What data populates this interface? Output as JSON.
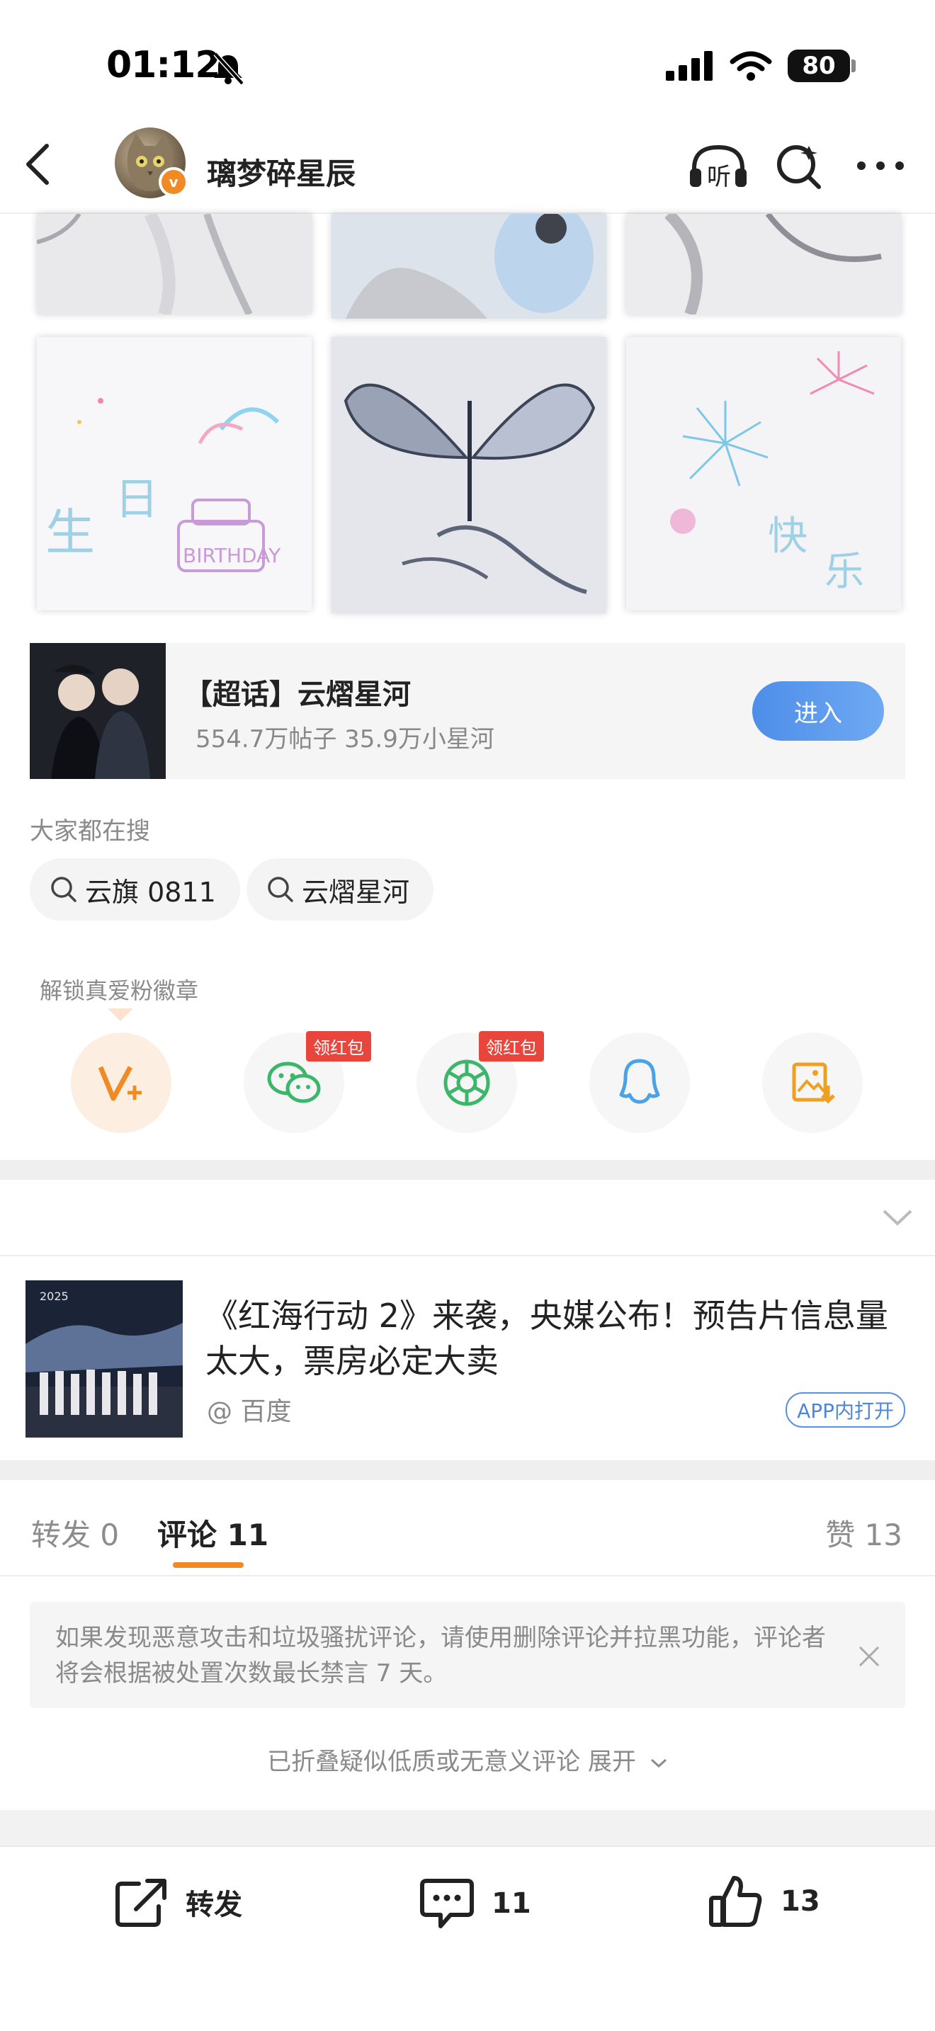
{
  "status_bar": {
    "time": "01:12",
    "battery": "80"
  },
  "nav": {
    "title": "璃梦碎星辰",
    "badge": "v",
    "listen_label": "听"
  },
  "super_topic": {
    "title": "【超话】云熠星河",
    "stats": "554.7万帖子  35.9万小星河",
    "enter_label": "进入"
  },
  "trending": {
    "label": "大家都在搜",
    "items": [
      {
        "text": "云旗 0811"
      },
      {
        "text": "云熠星河"
      }
    ]
  },
  "share": {
    "unlock_label": "解锁真爱粉徽章",
    "redpack_label": "领红包",
    "items": [
      {
        "icon": "vplus-icon"
      },
      {
        "icon": "wechat-icon"
      },
      {
        "icon": "moments-icon"
      },
      {
        "icon": "qq-icon"
      },
      {
        "icon": "save-image-icon"
      }
    ]
  },
  "link_card": {
    "title": "《红海行动 2》来袭，央媒公布！预告片信息量太大，票房必定大卖",
    "source": "@ 百度",
    "open_label": "APP内打开"
  },
  "tabs": {
    "repost": "转发 0",
    "comments": "评论 11",
    "likes": "赞 13"
  },
  "notice": {
    "text": "如果发现恶意攻击和垃圾骚扰评论，请使用删除评论并拉黑功能，评论者将会根据被处置次数最长禁言 7 天。"
  },
  "folded_comments": {
    "text": "已折叠疑似低质或无意义评论 展开"
  },
  "bottom_bar": {
    "repost_label": "转发",
    "comment_count": "11",
    "like_count": "13"
  },
  "colors": {
    "accent": "#f08a24",
    "link_blue": "#4d86dc",
    "enter_btn": "#5b98ec",
    "redpack": "#e8463c"
  }
}
